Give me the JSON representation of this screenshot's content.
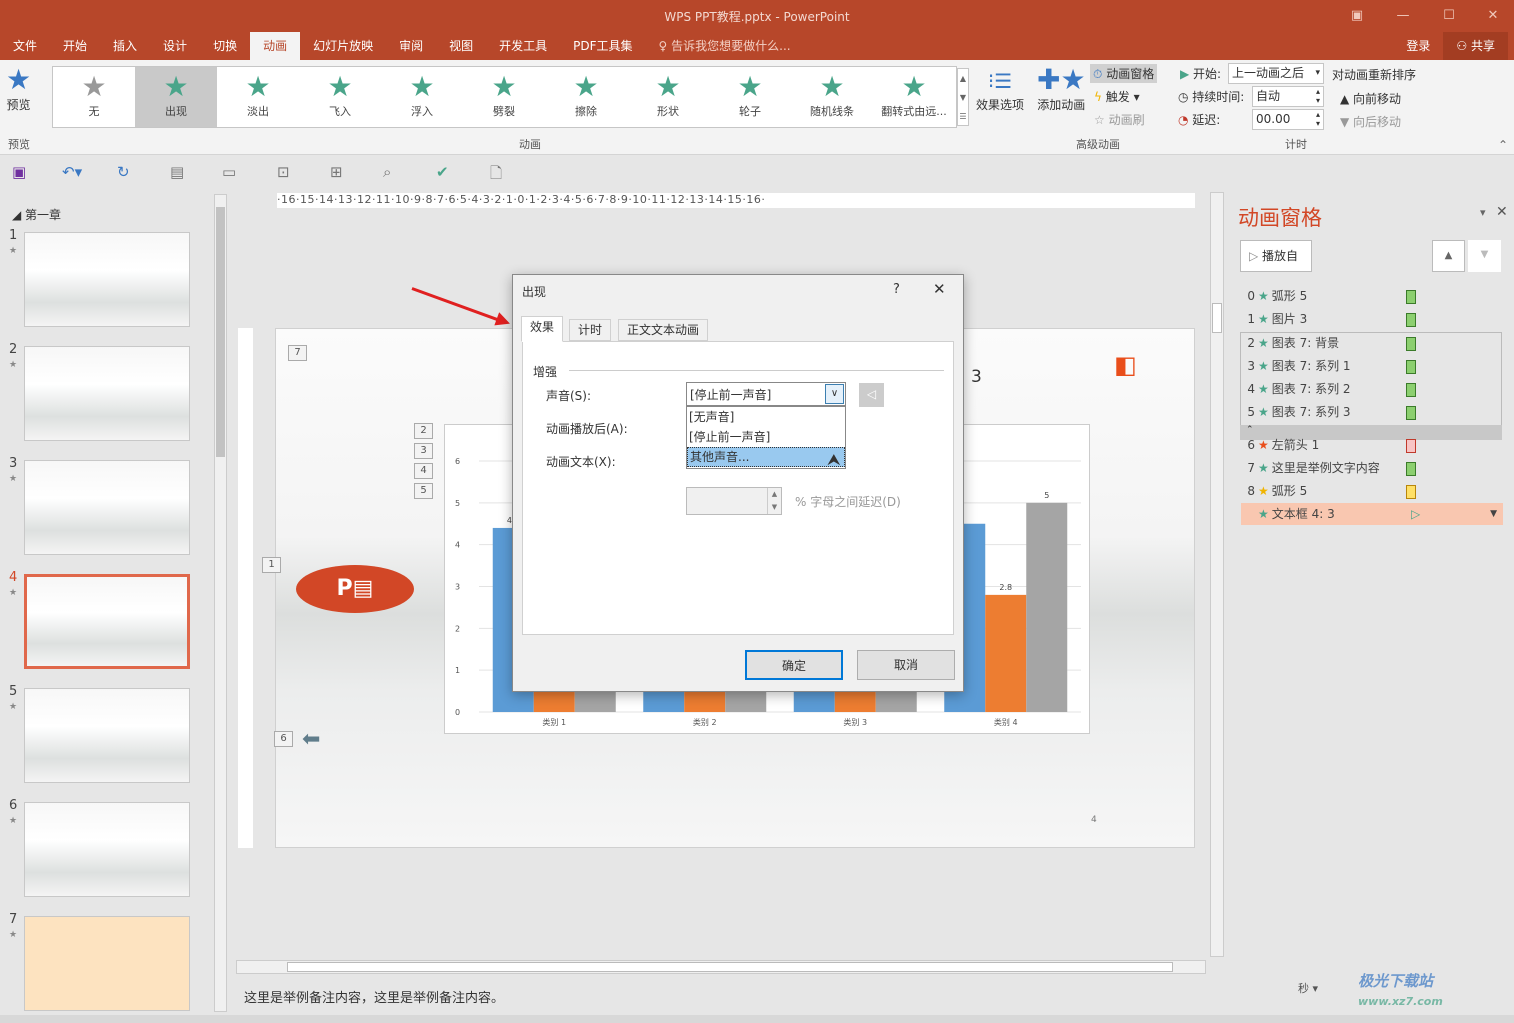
{
  "window": {
    "title": "WPS PPT教程.pptx - PowerPoint"
  },
  "tabs": [
    {
      "label": "文件"
    },
    {
      "label": "开始"
    },
    {
      "label": "插入"
    },
    {
      "label": "设计"
    },
    {
      "label": "切换"
    },
    {
      "label": "动画",
      "active": true
    },
    {
      "label": "幻灯片放映"
    },
    {
      "label": "审阅"
    },
    {
      "label": "视图"
    },
    {
      "label": "开发工具"
    },
    {
      "label": "PDF工具集"
    }
  ],
  "tell_me": "告诉我您想要做什么...",
  "login": "登录",
  "share": "共享",
  "ribbon": {
    "preview": "预览",
    "preview_group": "预览",
    "animations": [
      {
        "label": "无"
      },
      {
        "label": "出现",
        "selected": true
      },
      {
        "label": "淡出"
      },
      {
        "label": "飞入"
      },
      {
        "label": "浮入"
      },
      {
        "label": "劈裂"
      },
      {
        "label": "擦除"
      },
      {
        "label": "形状"
      },
      {
        "label": "轮子"
      },
      {
        "label": "随机线条"
      },
      {
        "label": "翻转式由远..."
      }
    ],
    "effect_options": "效果选项",
    "animation_group": "动画",
    "add_animation": "添加动画",
    "animation_pane": "动画窗格",
    "trigger": "触发",
    "animation_painter": "动画刷",
    "advanced_group": "高级动画",
    "start_label": "开始:",
    "start_value": "上一动画之后",
    "duration_label": "持续时间:",
    "duration_value": "自动",
    "delay_label": "延迟:",
    "delay_value": "00.00",
    "timing_group": "计时",
    "reorder": "对动画重新排序",
    "move_earlier": "向前移动",
    "move_later": "向后移动"
  },
  "thumbnails": {
    "section": "第一章",
    "slides": [
      {
        "num": "1"
      },
      {
        "num": "2"
      },
      {
        "num": "3"
      },
      {
        "num": "4",
        "selected": true
      },
      {
        "num": "5"
      },
      {
        "num": "6"
      },
      {
        "num": "7"
      }
    ]
  },
  "ruler": "·16·15·14·13·12·11·10·9·8·7·6·5·4·3·2·1·0·1·2·3·4·5·6·7·8·9·10·11·12·13·14·15·16·",
  "slide": {
    "badges": [
      "7",
      "2",
      "3",
      "4",
      "5",
      "1",
      "6"
    ],
    "number_text": "3",
    "page_num": "4"
  },
  "chart_data": {
    "type": "bar",
    "categories": [
      "类别 1",
      "类别 2",
      "类别 3",
      "类别 4"
    ],
    "series": [
      {
        "values": [
          4.4,
          2.5,
          3.5,
          4.5
        ],
        "color": "#5b9bd5"
      },
      {
        "values": [
          2.4,
          4.4,
          1.8,
          2.8
        ],
        "color": "#ed7d31"
      },
      {
        "values": [
          2,
          2,
          3,
          5
        ],
        "color": "#a5a5a5"
      }
    ],
    "yticks": [
      "0",
      "1",
      "2",
      "3",
      "4",
      "5",
      "6"
    ],
    "ylim": [
      0,
      6
    ],
    "visible_labels": {
      "s1c1": "4.4",
      "s2c4": "2.8",
      "s3c4": "5"
    },
    "grid": true
  },
  "dialog": {
    "title": "出现",
    "help": "?",
    "tabs": [
      "效果",
      "计时",
      "正文文本动画"
    ],
    "group": "增强",
    "sound_label": "声音(S):",
    "sound_value": "[停止前一声音]",
    "after_label": "动画播放后(A):",
    "text_label": "动画文本(X):",
    "sound_options": [
      "[无声音]",
      "[停止前一声音]",
      "其他声音..."
    ],
    "delay_suffix": "% 字母之间延迟(D)",
    "ok": "确定",
    "cancel": "取消"
  },
  "pane": {
    "title": "动画窗格",
    "play_from": "播放自",
    "items": [
      {
        "n": "0",
        "name": "弧形 5",
        "color": "green"
      },
      {
        "n": "1",
        "name": "图片 3",
        "color": "green"
      },
      {
        "n": "2",
        "name": "图表 7: 背景",
        "color": "green"
      },
      {
        "n": "3",
        "name": "图表 7: 系列 1",
        "color": "green"
      },
      {
        "n": "4",
        "name": "图表 7: 系列 2",
        "color": "green"
      },
      {
        "n": "5",
        "name": "图表 7: 系列 3",
        "color": "green"
      },
      {
        "n": "6",
        "name": "左箭头 1",
        "color": "red"
      },
      {
        "n": "7",
        "name": "这里是举例文字内容",
        "color": "green"
      },
      {
        "n": "8",
        "name": "弧形 5",
        "color": "yellow"
      },
      {
        "n": "",
        "name": "文本框 4: 3",
        "color": "green",
        "selected": true
      }
    ],
    "seconds": "秒"
  },
  "notes": "这里是举例备注内容，这里是举例备注内容。",
  "colors": {
    "accent": "#b7472a",
    "pane_title": "#d24726",
    "selection": "#f9c7b0"
  }
}
